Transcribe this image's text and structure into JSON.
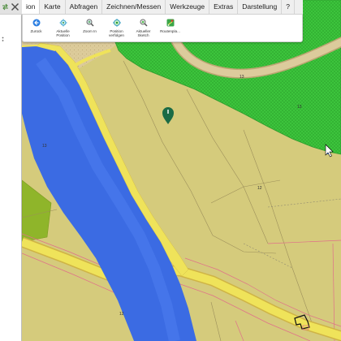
{
  "left_controls": {
    "collapse_icon": "collapse-panel-icon",
    "close_icon": "close-icon"
  },
  "tabs": [
    {
      "label": "ion",
      "active": true
    },
    {
      "label": "Karte",
      "active": false
    },
    {
      "label": "Abfragen",
      "active": false
    },
    {
      "label": "Zeichnen/Messen",
      "active": false
    },
    {
      "label": "Werkzeuge",
      "active": false
    },
    {
      "label": "Extras",
      "active": false
    },
    {
      "label": "Darstellung",
      "active": false
    },
    {
      "label": "?",
      "active": false
    }
  ],
  "ribbon": {
    "buttons": [
      {
        "label": "Zurück",
        "icon": "back-arrow-icon"
      },
      {
        "label": "Aktuelle Position",
        "icon": "current-position-icon"
      },
      {
        "label": "Zoom In",
        "icon": "zoom-in-icon"
      },
      {
        "label": "Position verfolgen",
        "icon": "track-position-icon"
      },
      {
        "label": "Aktueller Sketch",
        "icon": "current-sketch-icon"
      },
      {
        "label": "Routenpla...",
        "icon": "route-planner-icon"
      }
    ]
  },
  "map": {
    "parcel_labels": [
      "13",
      "13",
      "13",
      "12",
      "12"
    ],
    "marker_icon": "map-pin-icon",
    "cursor_icon": "mouse-cursor-icon"
  },
  "colors": {
    "land": "#d5cb7c",
    "sand": "#dccb9a",
    "forest": "#3cc43c",
    "forest_hatch": "#2a9e2a",
    "forest_road": "#dccb9c",
    "river": "#3b6be3",
    "road": "#efe35a",
    "road_edge": "#cfb445",
    "olive_patch": "#8fb52a",
    "parcel_line": "#e0708a",
    "marker": "#1b6b45",
    "accent": "#2a7de1"
  }
}
